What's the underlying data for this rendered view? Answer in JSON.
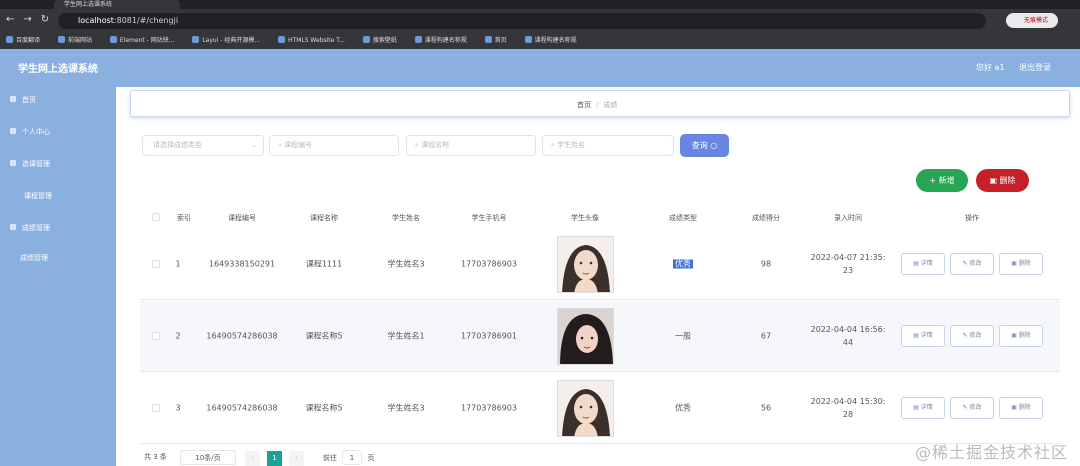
{
  "browser": {
    "tab_title": "学生网上选课系统",
    "url_host": "localhost",
    "url_rest": ":8081/#/chengji",
    "profile_label": "无痕模式",
    "bookmarks": [
      "百度翻译",
      "前端网站",
      "Element - 网站快...",
      "Layui - 经典开源模...",
      "HTML5 Website T...",
      "搜索壁纸",
      "课程构建名称规",
      "首页",
      "课程构建名称规"
    ]
  },
  "header": {
    "title": "学生网上选课系统",
    "user": "您好 a1",
    "logout": "退出登录"
  },
  "sidebar": {
    "items": [
      {
        "label": "首页"
      },
      {
        "label": "个人中心"
      },
      {
        "label": "选课管理"
      },
      {
        "label": "课程管理"
      },
      {
        "label": "成绩管理"
      },
      {
        "label": "成绩管理"
      }
    ]
  },
  "breadcrumb": {
    "home": "首页",
    "separator": "/",
    "current": "成绩"
  },
  "search": {
    "placeholders": [
      "请选择成绩类型",
      "课程编号",
      "课程名称",
      "学生姓名"
    ],
    "search_label": "查询 ○",
    "add_label": "+ 新增",
    "delete_label": "删除"
  },
  "table": {
    "columns": [
      "索引",
      "课程编号",
      "课程名称",
      "学生姓名",
      "学生手机号",
      "学生头像",
      "成绩类型",
      "成绩得分",
      "录入时间",
      "操作"
    ],
    "rows": [
      {
        "index": "1",
        "course_no": "1649338150291",
        "course_name": "课程1111",
        "student_name": "学生姓名3",
        "phone": "17703786903",
        "grade_type": "优秀",
        "score": "98",
        "time_line1": "2022-04-07 21:35:",
        "time_line2": "23"
      },
      {
        "index": "2",
        "course_no": "16490574286038",
        "course_name": "课程名称5",
        "student_name": "学生姓名1",
        "phone": "17703786901",
        "grade_type": "一般",
        "score": "67",
        "time_line1": "2022-04-04 16:56:",
        "time_line2": "44"
      },
      {
        "index": "3",
        "course_no": "16490574286038",
        "course_name": "课程名称5",
        "student_name": "学生姓名3",
        "phone": "17703786903",
        "grade_type": "优秀",
        "score": "56",
        "time_line1": "2022-04-04 15:30:",
        "time_line2": "28"
      }
    ],
    "actions": {
      "detail": "详情",
      "edit": "修改",
      "delete": "删除"
    }
  },
  "pagination": {
    "total": "共 3 条",
    "page_size": "10条/页",
    "current_page": "1",
    "goto_label": "前往",
    "goto_value": "1",
    "page_suffix": "页"
  },
  "watermark": "@稀土掘金技术社区",
  "colors": {
    "sidebar": "#8ab0df",
    "primary": "#6887e3",
    "success": "#27a553",
    "danger": "#c71f27"
  }
}
